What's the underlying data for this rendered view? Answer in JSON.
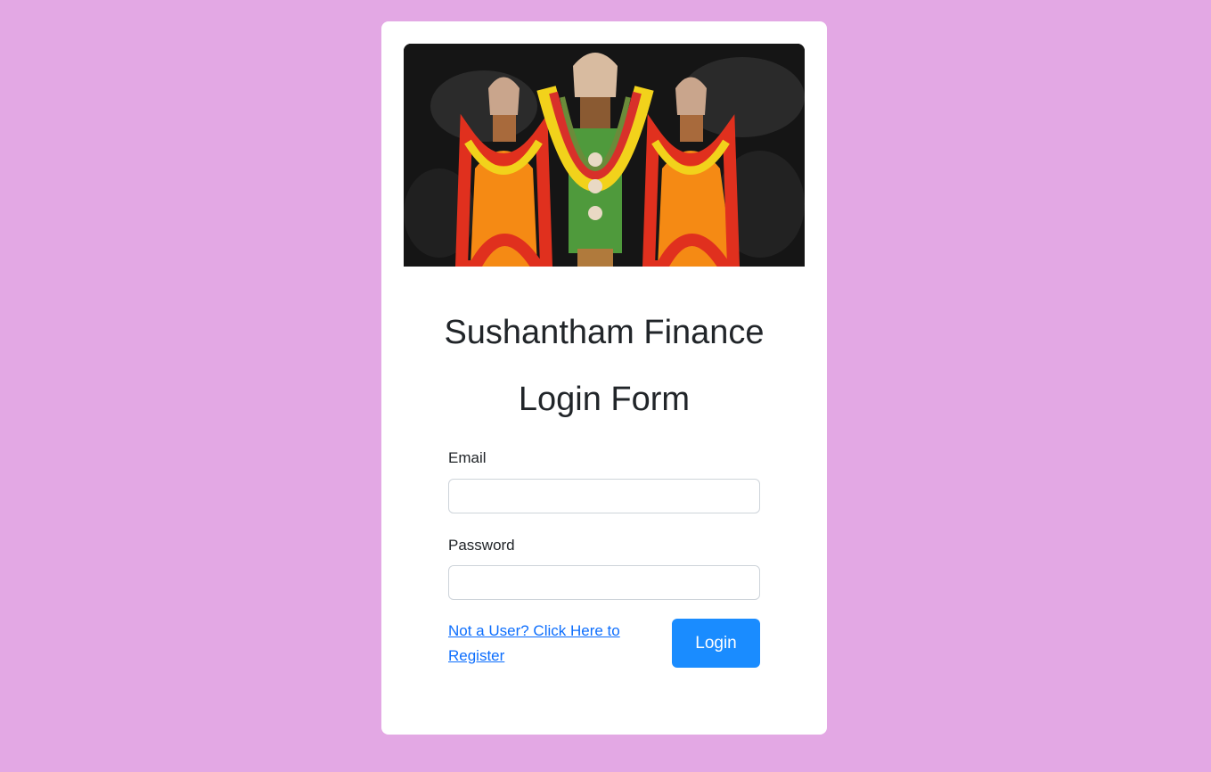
{
  "brand": {
    "title": "Sushantham Finance",
    "subtitle": "Login Form",
    "image_icon": "deity-banner-image"
  },
  "form": {
    "email_label": "Email",
    "email_value": "",
    "email_placeholder": "",
    "password_label": "Password",
    "password_value": "",
    "password_placeholder": "",
    "register_link": "Not a User? Click Here to Register",
    "login_button": "Login"
  },
  "colors": {
    "page_background": "#e3a8e4",
    "card_background": "#ffffff",
    "button": "#1a8cff",
    "link": "#0d6efd"
  }
}
